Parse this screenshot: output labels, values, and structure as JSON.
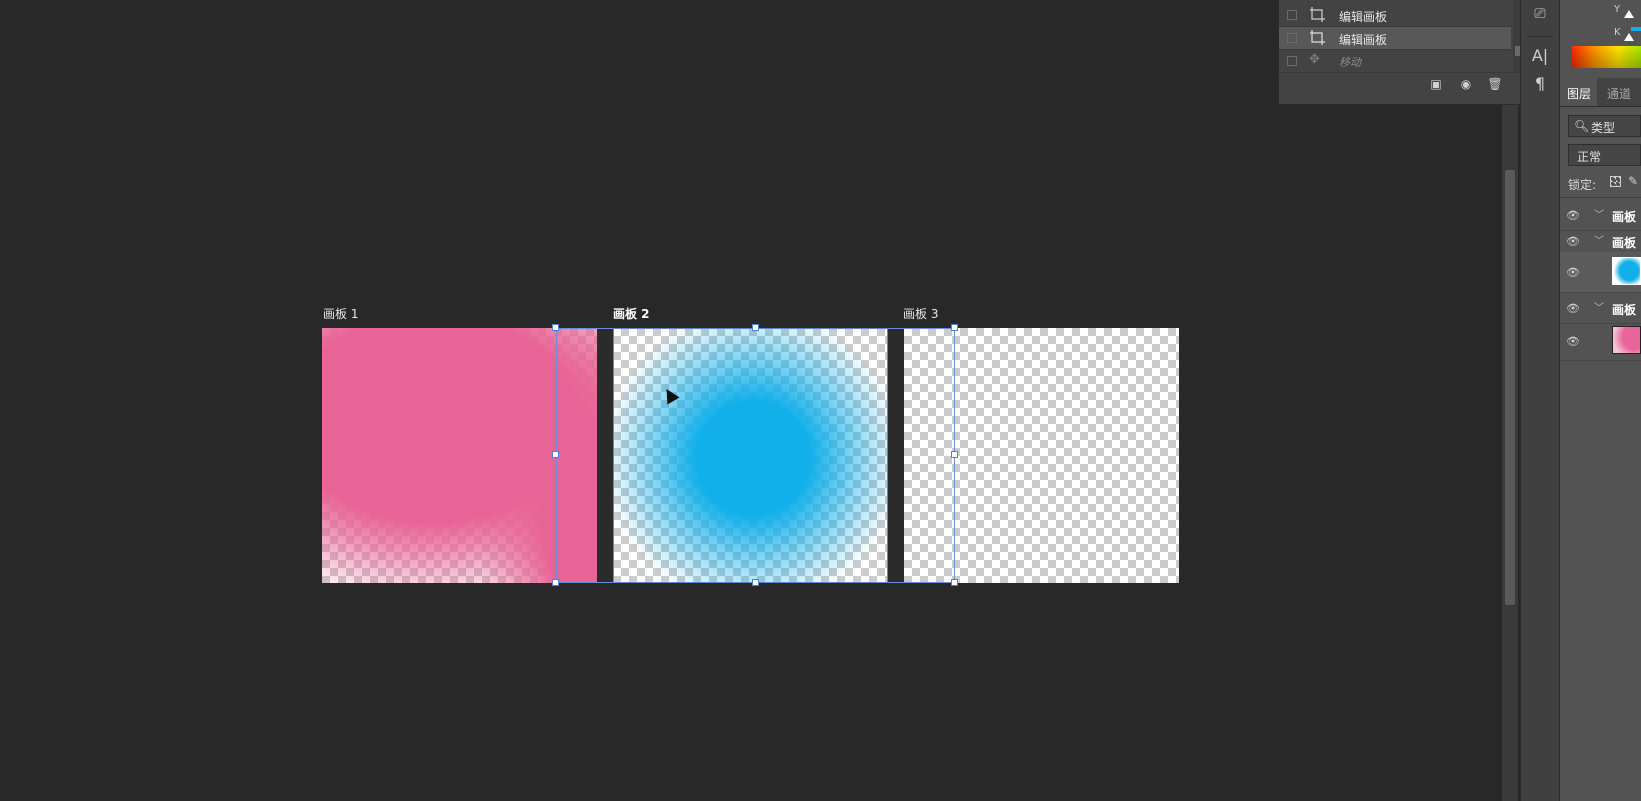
{
  "canvas": {
    "artboards": [
      {
        "label": "画板 1"
      },
      {
        "label": "画板 2"
      },
      {
        "label": "画板 3"
      }
    ]
  },
  "history": {
    "items": [
      {
        "label": "编辑画板",
        "selected": false
      },
      {
        "label": "编辑画板",
        "selected": true
      },
      {
        "label": "移动",
        "selected": false
      }
    ],
    "footer": {
      "new_doc_icon": "new-document-from-state-icon",
      "snapshot_icon": "camera-icon",
      "delete_icon": "trash-icon"
    }
  },
  "tools": {
    "stamp_icon": "stamp-icon",
    "character_label": "A|",
    "paragraph_label": "¶"
  },
  "color_panel": {
    "y_label": "Y",
    "k_label": "K"
  },
  "layers_panel": {
    "tabs": [
      {
        "label": "图层",
        "active": true
      },
      {
        "label": "通道",
        "active": false
      }
    ],
    "filter_label": "类型",
    "blend_mode": "正常",
    "lock_label": "锁定:",
    "layers": [
      {
        "type": "group",
        "name": "画板"
      },
      {
        "type": "group",
        "name": "画板"
      },
      {
        "type": "layer",
        "name": ""
      },
      {
        "type": "group",
        "name": "画板"
      },
      {
        "type": "layer",
        "name": ""
      }
    ]
  },
  "colors": {
    "pink": "#e9649a",
    "blue": "#12b0eb",
    "selection": "#6a8fd8"
  }
}
